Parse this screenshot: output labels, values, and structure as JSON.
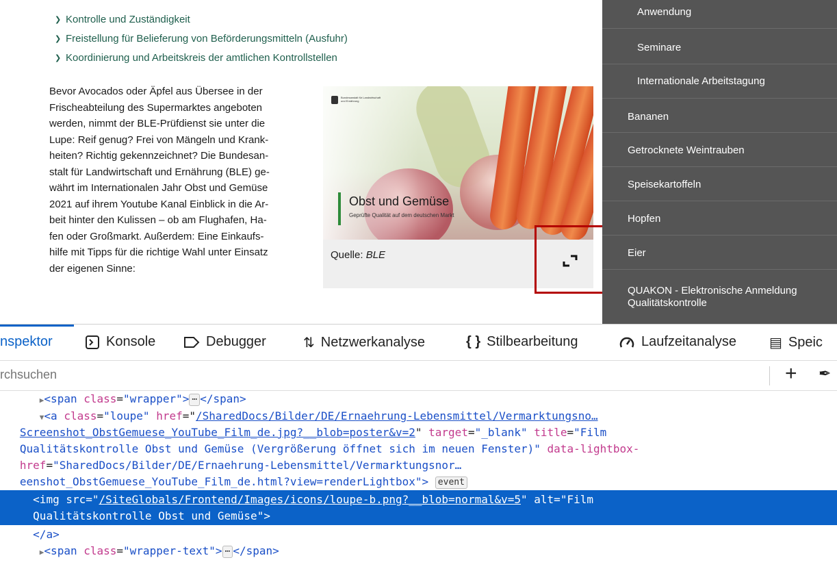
{
  "accordion": [
    "Kontrolle und Zuständigkeit",
    "Freistellung für Belieferung von Beförderungsmitteln (Ausfuhr)",
    "Koordinierung und Arbeitskreis der amtlichen Kontrollstellen"
  ],
  "body_lines": [
    "Bevor Avocados oder Äpfel aus Übersee in der",
    "Frischeabteilung des Supermarktes angeboten",
    "werden, nimmt der BLE-Prüfdienst sie unter die",
    "Lupe: Reif genug? Frei von Mängeln und Krank-",
    "heiten? Richtig gekennzeichnet? Die Bundesan-",
    "stalt für Landwirtschaft und Ernährung (BLE) ge-",
    "währt im Internationalen Jahr Obst und Gemüse",
    "2021 auf ihrem Youtube Kanal Einblick in die Ar-",
    "beit hinter den Kulissen – ob am Flughafen, Ha-",
    "fen oder Großmarkt. Außerdem: Eine Einkaufs-",
    "hilfe mit Tipps für die richtige Wahl unter Einsatz",
    "der eigenen Sinne:"
  ],
  "media": {
    "logo_text": "Bundesanstalt für Landwirtschaft und Ernährung",
    "title": "Obst und Gemüse",
    "subtitle": "Geprüfte Qualität auf dem deutschen Markt",
    "caption_label": "Quelle:",
    "caption_source": "BLE",
    "highlight_color": "#b30000"
  },
  "sidenav": {
    "items": [
      {
        "label": "Anwendung",
        "level": "sub"
      },
      {
        "label": "Seminare",
        "level": "sub"
      },
      {
        "label": "Internationale Arbeitstagung",
        "level": "sub"
      },
      {
        "label": "Bananen",
        "level": "top"
      },
      {
        "label": "Getrocknete Weintrauben",
        "level": "top"
      },
      {
        "label": "Speisekartoffeln",
        "level": "top"
      },
      {
        "label": "Hopfen",
        "level": "top"
      },
      {
        "label": "Eier",
        "level": "top"
      },
      {
        "label": "QUAKON - Elektronische Anmeldung",
        "label2": "Qualitätskontrolle",
        "level": "top"
      }
    ]
  },
  "devtools": {
    "tabs": [
      {
        "label": "nspektor",
        "icon": "inspector-icon",
        "active": true
      },
      {
        "label": "Konsole",
        "icon": "console-icon"
      },
      {
        "label": "Debugger",
        "icon": "debugger-icon"
      },
      {
        "label": "Netzwerkanalyse",
        "icon": "network-icon"
      },
      {
        "label": "Stilbearbeitung",
        "icon": "style-editor-icon"
      },
      {
        "label": "Laufzeitanalyse",
        "icon": "performance-icon"
      },
      {
        "label": "Speic",
        "icon": "storage-icon"
      }
    ],
    "search_placeholder": "rchsuchen",
    "accent_color": "#0b62c8",
    "code": {
      "l1_tag_open": "<span",
      "l1_attr": " class",
      "l1_val": "\"wrapper\"",
      "l1_close": ">",
      "l1_end": "</span>",
      "l2_tag": "<a",
      "l2_attr1": " class",
      "l2_val1": "\"loupe\"",
      "l2_attr2": " href",
      "l2_url1": "/SharedDocs/Bilder/DE/Ernaehrung-Lebensmittel/Vermarktungsno…",
      "l3_url": "Screenshot_ObstGemuese_YouTube_Film_de.jpg?__blob=poster&v=2",
      "l3_attr_target": " target",
      "l3_val_target": "\"_blank\"",
      "l3_attr_title": " title",
      "l3_val_title": "\"Film",
      "l4_val": "Qualitätskontrolle Obst und Gemüse (Vergrößerung öffnet sich im neuen Fenster)\"",
      "l4_attr": " data-lightbox-",
      "l5_attr": "href",
      "l5_val": "\"SharedDocs/Bilder/DE/Ernaehrung-Lebensmittel/Vermarktungsnor…",
      "l6_val": "eenshot_ObstGemuese_YouTube_Film_de.html?view=renderLightbox\"",
      "l6_close": ">",
      "event_badge": "event",
      "l7_tag": "<img",
      "l7_attr1": " src",
      "l7_url": "/SiteGlobals/Frontend/Images/icons/loupe-b.png?__blob=normal&v=5",
      "l7_attr2": " alt",
      "l7_val2": "\"Film",
      "l8_val": "Qualitätskontrolle Obst und Gemüse\"",
      "l8_close": ">",
      "l9": "</a>",
      "l10_tag_open": "<span",
      "l10_attr": " class",
      "l10_val": "\"wrapper-text\"",
      "l10_close": ">",
      "l10_end": "</span>"
    }
  }
}
